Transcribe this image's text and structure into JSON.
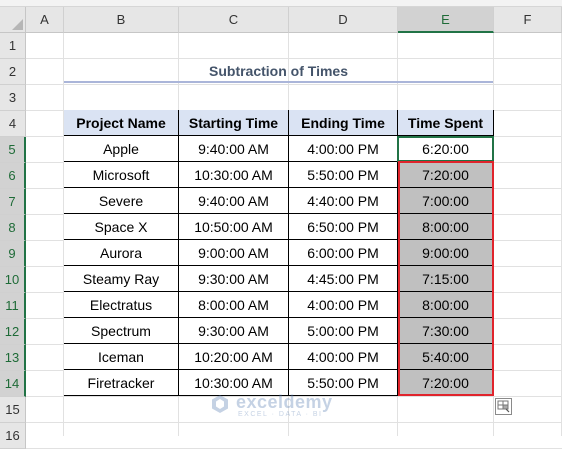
{
  "columns": [
    "A",
    "B",
    "C",
    "D",
    "E",
    "F"
  ],
  "rows": [
    "1",
    "2",
    "3",
    "4",
    "5",
    "6",
    "7",
    "8",
    "9",
    "10",
    "11",
    "12",
    "13",
    "14",
    "15",
    "16"
  ],
  "title": "Subtraction of Times",
  "table": {
    "headers": [
      "Project Name",
      "Starting Time",
      "Ending Time",
      "Time Spent"
    ],
    "rows": [
      [
        "Apple",
        "9:40:00 AM",
        "4:00:00 PM",
        "6:20:00"
      ],
      [
        "Microsoft",
        "10:30:00 AM",
        "5:50:00 PM",
        "7:20:00"
      ],
      [
        "Severe",
        "9:40:00 AM",
        "4:40:00 PM",
        "7:00:00"
      ],
      [
        "Space X",
        "10:50:00 AM",
        "6:50:00 PM",
        "8:00:00"
      ],
      [
        "Aurora",
        "9:00:00 AM",
        "6:00:00 PM",
        "9:00:00"
      ],
      [
        "Steamy Ray",
        "9:30:00 AM",
        "4:45:00 PM",
        "7:15:00"
      ],
      [
        "Electratus",
        "8:00:00 AM",
        "4:00:00 PM",
        "8:00:00"
      ],
      [
        "Spectrum",
        "9:30:00 AM",
        "5:00:00 PM",
        "7:30:00"
      ],
      [
        "Iceman",
        "10:20:00 AM",
        "4:00:00 PM",
        "5:40:00"
      ],
      [
        "Firetracker",
        "10:30:00 AM",
        "5:50:00 PM",
        "7:20:00"
      ]
    ]
  },
  "selected_cell": "E5",
  "highlight_range": "E6:E14",
  "colors": {
    "header_fill": "#dae3f3",
    "highlight_fill": "#c0c0c0",
    "highlight_border": "#e0242c",
    "selection": "#217346",
    "title_text": "#44546a"
  },
  "watermark": {
    "brand": "exceldemy",
    "tagline": "EXCEL · DATA · BI"
  }
}
